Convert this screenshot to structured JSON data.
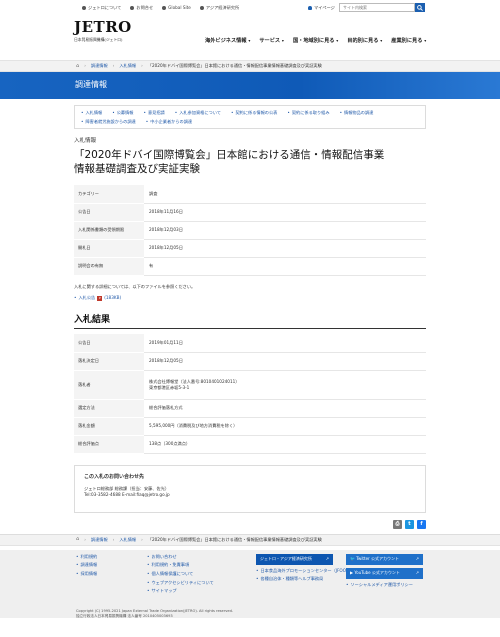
{
  "header": {
    "top_links": [
      "ジェトロについて",
      "お問合せ",
      "Global Site",
      "アジア経済研究所"
    ],
    "mypage": "マイページ",
    "search_placeholder": "サイト内検索",
    "logo_text": "JETRO",
    "logo_org": "日本貿易振興機構(ジェトロ)",
    "nav": [
      "海外ビジネス情報",
      "サービス",
      "国・地域別に見る",
      "目的別に見る",
      "産業別に見る"
    ]
  },
  "breadcrumb": [
    "調達情報",
    "入札情報",
    "「2020年ドバイ国際博覧会」日本館における通信・情報配信事業情報基礎調査及び実証実験"
  ],
  "band_title": "調達情報",
  "subnav": [
    "入札情報",
    "公募情報",
    "意見招請",
    "入札参加資格について",
    "契約に係る情報の公表",
    "契約に係る取り組み",
    "情報物品の調達",
    "障害者就労施設からの調達",
    "中小企業者からの調達"
  ],
  "kicker": "入札情報",
  "title_line1": "「2020年ドバイ国際博覧会」日本館における通信・情報配信事業",
  "title_line2": "情報基礎調査及び実証実験",
  "info_rows": [
    {
      "label": "カテゴリー",
      "value": "調査"
    },
    {
      "label": "公告日",
      "value": "2018年11月16日"
    },
    {
      "label": "入札関係書類の受領期限",
      "value": "2018年12月03日"
    },
    {
      "label": "開札日",
      "value": "2018年12月05日"
    },
    {
      "label": "説明会の有無",
      "value": "有"
    }
  ],
  "note": "入札に関する詳細については、以下のファイルを参照ください。",
  "pdf_link": "入札公告",
  "pdf_size": "(183KB)",
  "result_heading": "入札結果",
  "result_rows": [
    {
      "label": "公告日",
      "value": "2019年01月11日"
    },
    {
      "label": "落札決定日",
      "value": "2018年12月05日"
    },
    {
      "label": "落札者",
      "value": "株式会社博報堂（法人番号:8010401024011）",
      "value2": "東京都港区赤坂5-3-1"
    },
    {
      "label": "選定方法",
      "value": "総合評価落札方式"
    },
    {
      "label": "落札金額",
      "value": "5,595,000円（消費税及び地方消費税を除く）"
    },
    {
      "label": "総合評価点",
      "value": "138点（300点満点）"
    }
  ],
  "contact": {
    "heading": "この入札のお問い合わせ先",
    "line1": "ジェトロ総務部 総務課（担当：安藤、佐光）",
    "line2": "Tel:03-3582-4688 E-mail:fiaq@jetro.go.jp"
  },
  "share_buttons": [
    {
      "name": "print-button",
      "glyph": "⎙",
      "color": "#777777"
    },
    {
      "name": "twitter-share-button",
      "glyph": "t",
      "color": "#1b95e0"
    },
    {
      "name": "facebook-share-button",
      "glyph": "f",
      "color": "#1877f2"
    }
  ],
  "footer": {
    "col1": [
      "利用規約",
      "調達情報",
      "採用情報"
    ],
    "col2": [
      "お問い合わせ",
      "利用規約・免責事項",
      "個人情報保護について",
      "ウェブアクセシビリティについて",
      "サイトマップ"
    ],
    "col3_button": "ジェトロ・アジア経済研究所",
    "col3": [
      "日本食品海外プロモーションセンター（JFOODO）",
      "各種自治体・種類等ヘルプ事務局"
    ],
    "col4_button1": "Twitter 公式アカウント",
    "col4_button2": "YouTube 公式アカウント",
    "col4": [
      "ソーシャルメディア運用ポリシー"
    ],
    "copyright1": "Copyright (C) 1995-2021 Japan External Trade Organization(JETRO). All rights reserved.",
    "copyright2": "独立行政法人日本貿易振興機構 法人番号 2010405003693"
  }
}
